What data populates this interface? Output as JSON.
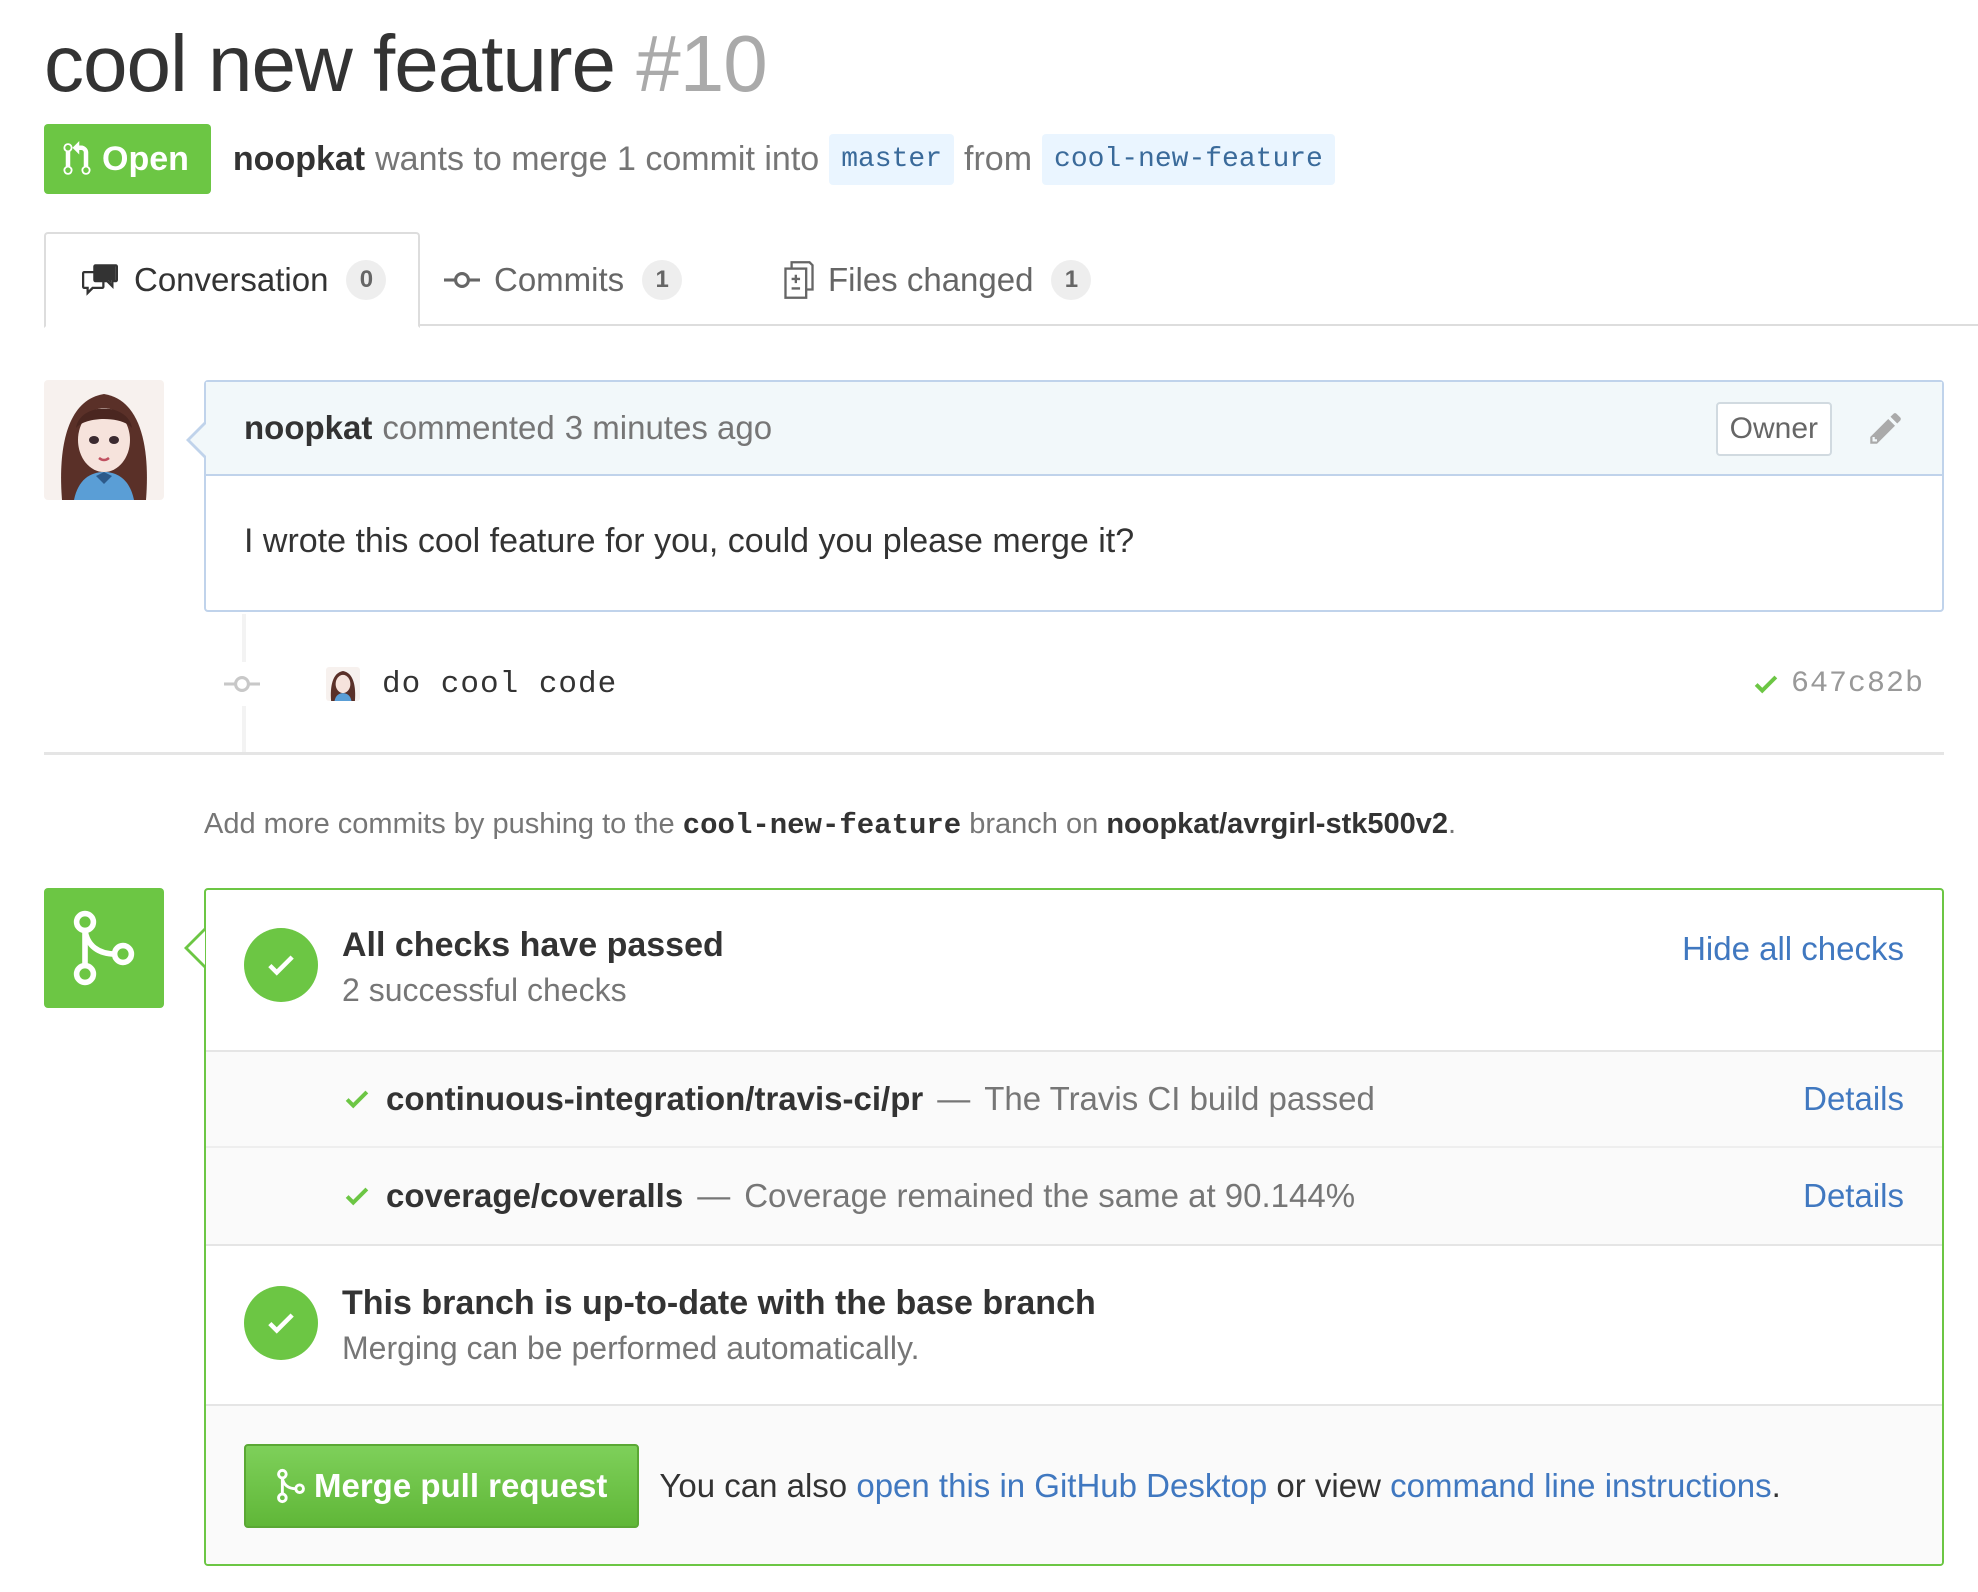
{
  "pr": {
    "title": "cool new feature",
    "number": "#10",
    "state": "Open",
    "author": "noopkat",
    "merge_text": "wants to merge 1 commit into",
    "base_branch": "master",
    "from_text": "from",
    "head_branch": "cool-new-feature"
  },
  "tabs": [
    {
      "label": "Conversation",
      "count": "0",
      "icon": "comment-discussion-icon",
      "selected": true
    },
    {
      "label": "Commits",
      "count": "1",
      "icon": "git-commit-icon",
      "selected": false
    },
    {
      "label": "Files changed",
      "count": "1",
      "icon": "diff-icon",
      "selected": false
    }
  ],
  "comment": {
    "author": "noopkat",
    "action": "commented",
    "time": "3 minutes ago",
    "role_label": "Owner",
    "body": "I wrote this cool feature for you, could you please merge it?"
  },
  "commit": {
    "message": "do cool code",
    "sha": "647c82b",
    "status": "success"
  },
  "hint": {
    "prefix": "Add more commits by pushing to the",
    "branch": "cool-new-feature",
    "middle": "branch on",
    "repo": "noopkat/avrgirl-stk500v2",
    "suffix": "."
  },
  "merge_box": {
    "checks_heading": "All checks have passed",
    "checks_sub": "2 successful checks",
    "hide_link": "Hide all checks",
    "checks": [
      {
        "context": "continuous-integration/travis-ci/pr",
        "separator": "—",
        "description": "The Travis CI build passed",
        "link": "Details"
      },
      {
        "context": "coverage/coveralls",
        "separator": "—",
        "description": "Coverage remained the same at 90.144%",
        "link": "Details"
      }
    ],
    "branch_heading": "This branch is up-to-date with the base branch",
    "branch_sub": "Merging can be performed automatically.",
    "merge_button": "Merge pull request",
    "also_text": "You can also",
    "desktop_link": "open this in GitHub Desktop",
    "or_view_text": "or view",
    "cli_link": "command line instructions",
    "period": "."
  },
  "colors": {
    "open_green": "#6cc644",
    "link_blue": "#4078c0",
    "comment_border": "#c0d3eb"
  }
}
